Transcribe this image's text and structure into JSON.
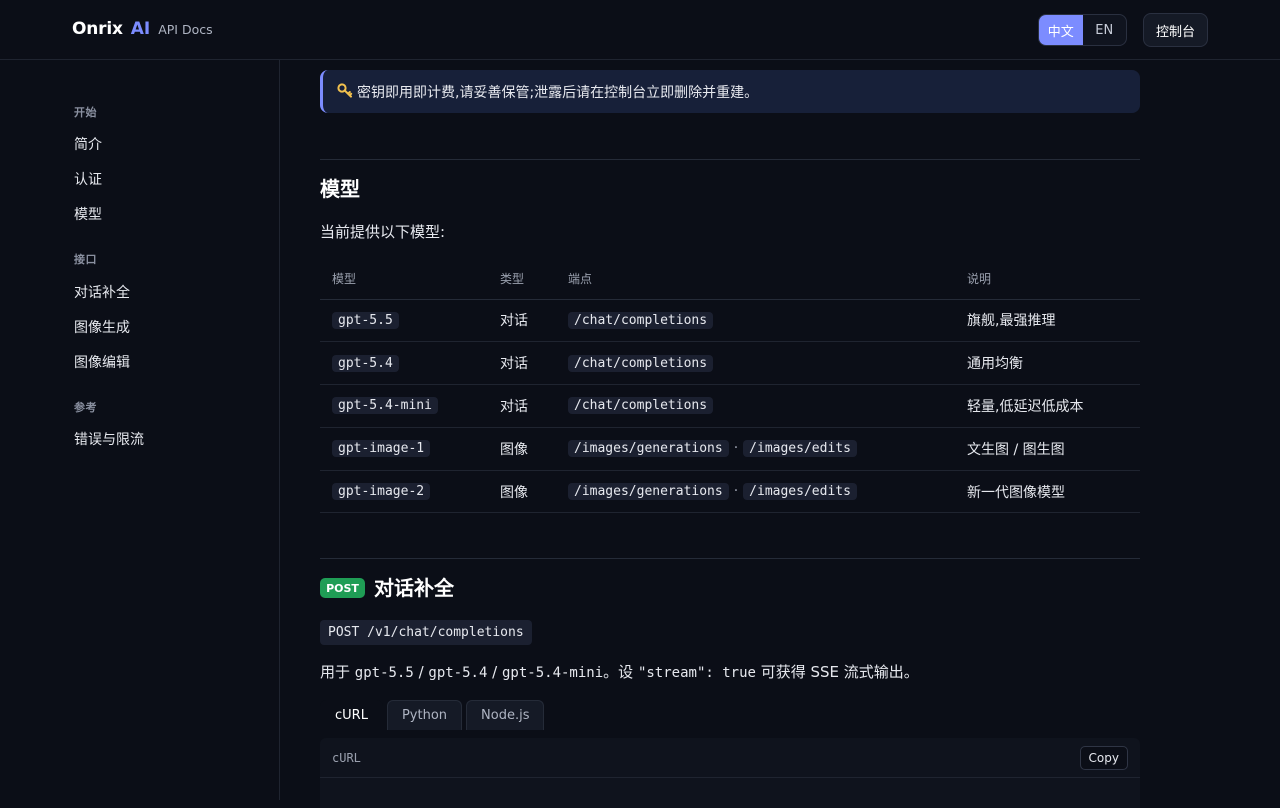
{
  "header": {
    "brand_name": "Onrix",
    "brand_ai": "AI",
    "brand_docs": "API Docs",
    "lang_zh": "中文",
    "lang_en": "EN",
    "console": "控制台"
  },
  "sidebar": {
    "groups": [
      {
        "title": "开始",
        "items": [
          "简介",
          "认证",
          "模型"
        ]
      },
      {
        "title": "接口",
        "items": [
          "对话补全",
          "图像生成",
          "图像编辑"
        ]
      },
      {
        "title": "参考",
        "items": [
          "错误与限流"
        ]
      }
    ]
  },
  "callout": {
    "icon": "key-icon",
    "text": "密钥即用即计费,请妥善保管;泄露后请在控制台立即删除并重建。"
  },
  "models_section": {
    "title": "模型",
    "intro": "当前提供以下模型:",
    "columns": [
      "模型",
      "类型",
      "端点",
      "说明"
    ],
    "rows": [
      {
        "model": "gpt-5.5",
        "type": "对话",
        "endpoints": [
          "/chat/completions"
        ],
        "desc": "旗舰,最强推理"
      },
      {
        "model": "gpt-5.4",
        "type": "对话",
        "endpoints": [
          "/chat/completions"
        ],
        "desc": "通用均衡"
      },
      {
        "model": "gpt-5.4-mini",
        "type": "对话",
        "endpoints": [
          "/chat/completions"
        ],
        "desc": "轻量,低延迟低成本"
      },
      {
        "model": "gpt-image-1",
        "type": "图像",
        "endpoints": [
          "/images/generations",
          "/images/edits"
        ],
        "desc": "文生图 / 图生图"
      },
      {
        "model": "gpt-image-2",
        "type": "图像",
        "endpoints": [
          "/images/generations",
          "/images/edits"
        ],
        "desc": "新一代图像模型"
      }
    ],
    "endpoint_separator": "·"
  },
  "chat_section": {
    "method": "POST",
    "title": "对话补全",
    "endpoint": "POST /v1/chat/completions",
    "usage": {
      "prefix": "用于 ",
      "m1": "gpt-5.5",
      "slash": " / ",
      "m2": "gpt-5.4",
      "m3": "gpt-5.4-mini",
      "mid": "。设 ",
      "code": "\"stream\": true",
      "suffix": " 可获得 SSE 流式输出。"
    },
    "tabs": [
      "cURL",
      "Python",
      "Node.js"
    ],
    "active_tab": 0,
    "code_lang": "cURL",
    "copy_label": "Copy"
  },
  "colors": {
    "accent": "#7c8cff",
    "post_badge": "#1f9d55",
    "background": "#0b0e17"
  }
}
